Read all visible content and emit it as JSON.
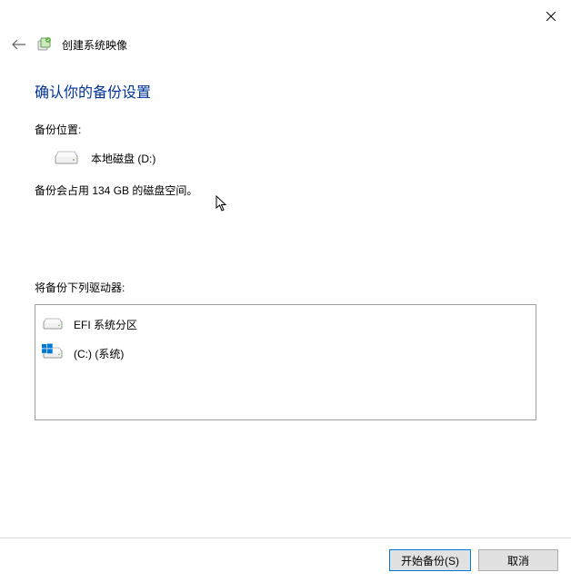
{
  "window": {
    "title": "创建系统映像"
  },
  "content": {
    "heading": "确认你的备份设置",
    "backup_location_label": "备份位置:",
    "backup_location_value": "本地磁盘 (D:)",
    "space_required": "备份会占用 134 GB 的磁盘空间。",
    "drives_label": "将备份下列驱动器:",
    "drives": [
      {
        "label": "EFI 系统分区"
      },
      {
        "label": "(C:) (系统)"
      }
    ]
  },
  "footer": {
    "start_label": "开始备份(S)",
    "cancel_label": "取消"
  }
}
